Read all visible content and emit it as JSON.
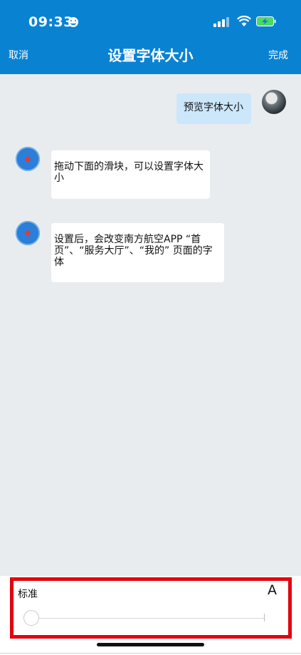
{
  "status_bar": {
    "time": "09:33"
  },
  "nav": {
    "cancel": "取消",
    "title": "设置字体大小",
    "done": "完成"
  },
  "messages": [
    {
      "sender": "user",
      "text": "预览字体大小"
    },
    {
      "sender": "bot",
      "text": "拖动下面的滑块，可以设置字体大小"
    },
    {
      "sender": "bot",
      "text": "设置后，会改变南方航空APP “首页”、“服务大厅”、“我的” 页面的字体"
    }
  ],
  "font_size": {
    "label": "标准",
    "preview_letter": "A",
    "level": 0
  }
}
